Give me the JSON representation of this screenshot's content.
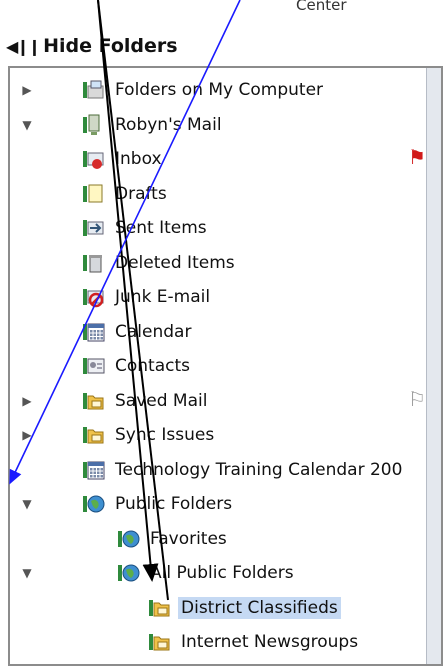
{
  "header": {
    "center_label": "Center",
    "hide_folders_label": "Hide Folders"
  },
  "tree": [
    {
      "name": "folders-on-my-computer",
      "label": "Folders on My Computer",
      "twisty": "closed",
      "icon": "computer-folder-icon",
      "indent": 0
    },
    {
      "name": "robyns-mail",
      "label": "Robyn's Mail",
      "twisty": "open",
      "icon": "server-icon",
      "indent": 0
    },
    {
      "name": "inbox",
      "label": "Inbox",
      "twisty": "none",
      "icon": "inbox-icon",
      "indent": 1,
      "flag": "red"
    },
    {
      "name": "drafts",
      "label": "Drafts",
      "twisty": "none",
      "icon": "drafts-icon",
      "indent": 1
    },
    {
      "name": "sent-items",
      "label": "Sent Items",
      "twisty": "none",
      "icon": "sent-items-icon",
      "indent": 1
    },
    {
      "name": "deleted-items",
      "label": "Deleted Items",
      "twisty": "none",
      "icon": "trash-icon",
      "indent": 1
    },
    {
      "name": "junk-email",
      "label": "Junk E-mail",
      "twisty": "none",
      "icon": "junk-icon",
      "indent": 1
    },
    {
      "name": "calendar",
      "label": "Calendar",
      "twisty": "none",
      "icon": "calendar-icon",
      "indent": 1
    },
    {
      "name": "contacts",
      "label": "Contacts",
      "twisty": "none",
      "icon": "contacts-icon",
      "indent": 1
    },
    {
      "name": "saved-mail",
      "label": "Saved Mail",
      "twisty": "closed",
      "icon": "folder-icon",
      "indent": 1,
      "flag": "outline"
    },
    {
      "name": "sync-issues",
      "label": "Sync Issues",
      "twisty": "closed",
      "icon": "folder-icon",
      "indent": 1
    },
    {
      "name": "technology-training-calendar",
      "label": "Technology Training Calendar 200",
      "twisty": "none",
      "icon": "calendar-icon",
      "indent": 1
    },
    {
      "name": "public-folders",
      "label": "Public Folders",
      "twisty": "open",
      "icon": "globe-icon",
      "indent": 1
    },
    {
      "name": "favorites",
      "label": "Favorites",
      "twisty": "none",
      "icon": "globe-icon",
      "indent": 2
    },
    {
      "name": "all-public-folders",
      "label": "All Public Folders",
      "twisty": "open",
      "icon": "globe-icon",
      "indent": 2
    },
    {
      "name": "district-classifieds",
      "label": "District Classifieds",
      "twisty": "none",
      "icon": "folder-icon",
      "indent": 3,
      "selected": true
    },
    {
      "name": "internet-newsgroups",
      "label": "Internet Newsgroups",
      "twisty": "none",
      "icon": "folder-icon",
      "indent": 3
    }
  ],
  "colors": {
    "selection": "#c5d9f3",
    "arrow_black": "#000000",
    "arrow_blue": "#1a1aff",
    "flag_red": "#d11a1a"
  }
}
